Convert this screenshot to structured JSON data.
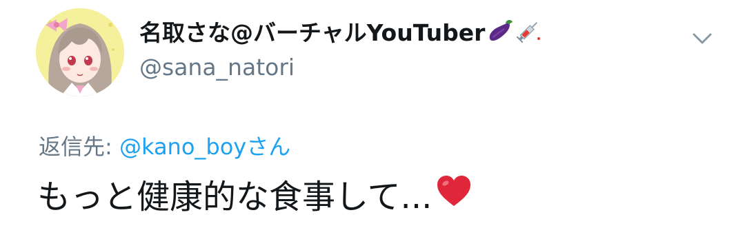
{
  "user": {
    "display_name": "名取さな@バーチャルYouTuber",
    "handle": "@sana_natori",
    "name_icons": [
      "eggplant-icon",
      "syringe-icon"
    ]
  },
  "reply": {
    "prefix": "返信先:",
    "mention": "@kano_boy",
    "suffix": "さん"
  },
  "tweet": {
    "text": "もっと健康的な食事して...",
    "trailing_icon": "red-heart-icon"
  },
  "colors": {
    "text": "#14171a",
    "secondary": "#657786",
    "link": "#1da1f2",
    "heart": "#e0263a",
    "eggplant": "#5b2a86"
  }
}
